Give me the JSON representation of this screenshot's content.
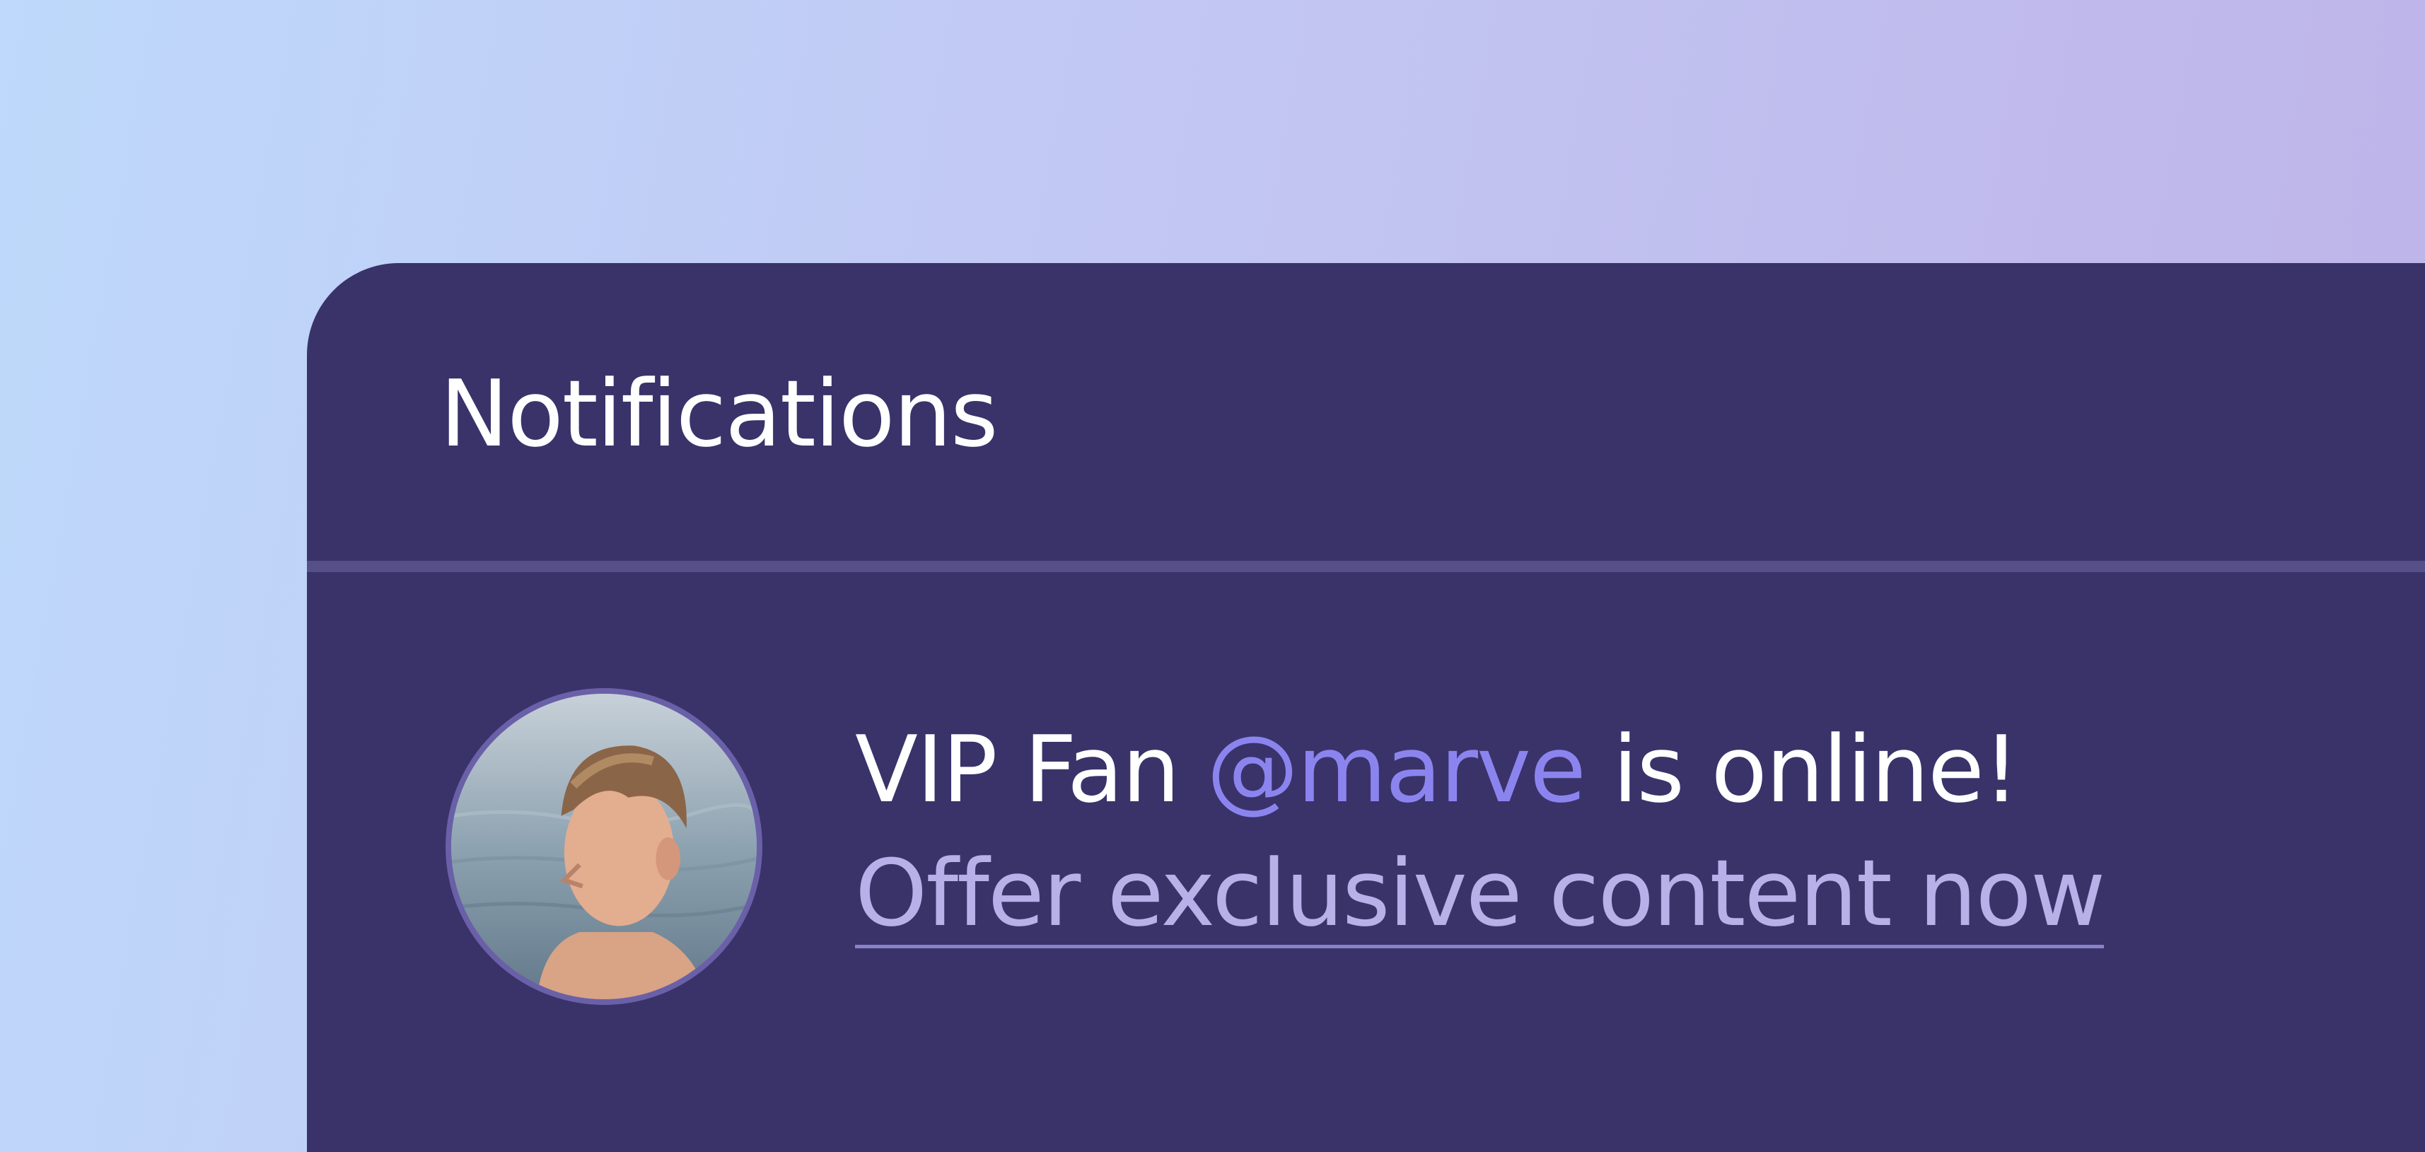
{
  "notifications": {
    "title": "Notifications",
    "items": [
      {
        "prefix": "VIP Fan ",
        "mention": "@marve",
        "suffix": " is online!",
        "cta": "Offer exclusive content now",
        "avatar_icon": "user-avatar-photo"
      }
    ]
  },
  "colors": {
    "panel": "#39336a",
    "divider": "#565089",
    "mention": "#8c84ee",
    "link": "#b8b0e8"
  }
}
